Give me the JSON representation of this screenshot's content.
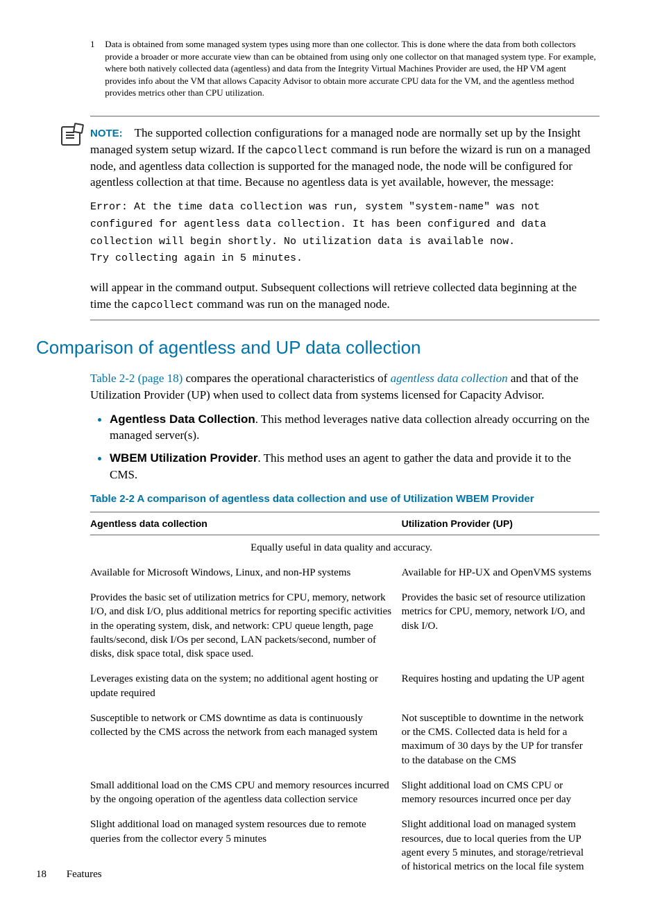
{
  "footnote": {
    "number": "1",
    "text": "Data is obtained from some managed system types using more than one collector. This is done where the data from both collectors provide a broader or more accurate view than can be obtained from using only one collector on that managed system type. For example, where both natively collected data (agentless) and data from the Integrity Virtual Machines Provider are used, the HP VM agent provides info about the VM that allows Capacity Advisor to obtain more accurate CPU data for the VM, and the agentless method provides metrics other than CPU utilization."
  },
  "note": {
    "label": "NOTE:",
    "text1_a": "The supported collection configurations for a managed node are normally set up by the Insight managed system setup wizard. If the ",
    "cmd1": "capcollect",
    "text1_b": " command is run before the wizard is run on a managed node, and agentless data collection is supported for the managed node, the node will be configured for agentless collection at that time. Because no agentless data is yet available, however, the message:",
    "code": "Error: At the time data collection was run, system \"system-name\" was not\nconfigured for agentless data collection. It has been configured and data\ncollection will begin shortly. No utilization data is available now.\nTry collecting again in 5 minutes.",
    "text2_a": "will appear in the command output. Subsequent collections will retrieve collected data beginning at the time the ",
    "cmd2": "capcollect",
    "text2_b": " command was run on the managed node."
  },
  "section": {
    "heading": "Comparison of agentless and UP data collection",
    "para_a": "Table 2-2 (page 18)",
    "para_b": " compares the operational characteristics of ",
    "para_c": "agentless data collection",
    "para_d": " and that of the Utilization Provider (UP) when used to collect data from systems licensed for Capacity Advisor.",
    "bullets": [
      {
        "strong": "Agentless Data Collection",
        "rest": ". This method leverages native data collection already occurring on the managed server(s)."
      },
      {
        "strong": "WBEM Utilization Provider",
        "rest": ". This method uses an agent to gather the data and provide it to the CMS."
      }
    ],
    "table_title": "Table 2-2 A comparison of agentless data collection and use of Utilization WBEM Provider"
  },
  "table": {
    "headers": [
      "Agentless data collection",
      "Utilization Provider (UP)"
    ],
    "spanrow": "Equally useful in data quality and accuracy.",
    "rows": [
      [
        "Available for Microsoft Windows, Linux, and non-HP systems",
        "Available for HP-UX and OpenVMS systems"
      ],
      [
        "Provides the basic set of utilization metrics for CPU, memory, network I/O, and disk I/O, plus additional metrics for reporting specific activities in the operating system, disk, and network: CPU queue length, page faults/second, disk I/Os per second, LAN packets/second, number of disks, disk space total, disk space used.",
        "Provides the basic set of resource utilization metrics for CPU, memory, network I/O, and disk I/O."
      ],
      [
        "Leverages existing data on the system; no additional agent hosting or update required",
        "Requires hosting and updating the UP agent"
      ],
      [
        "Susceptible to network or CMS downtime as data is continuously collected by the CMS across the network from each managed system",
        "Not susceptible to downtime in the network or the CMS. Collected data is held for a maximum of 30 days by the UP for transfer to the database on the CMS"
      ],
      [
        "Small additional load on the CMS CPU and memory resources incurred by the ongoing operation of the agentless data collection service",
        "Slight additional load on CMS CPU or memory resources incurred once per day"
      ],
      [
        "Slight additional load on managed system resources due to remote queries from the collector every 5 minutes",
        "Slight additional load on managed system resources, due to local queries from the UP agent every 5 minutes, and storage/retrieval of historical metrics on the local file system"
      ]
    ]
  },
  "footer": {
    "page": "18",
    "section": "Features"
  }
}
